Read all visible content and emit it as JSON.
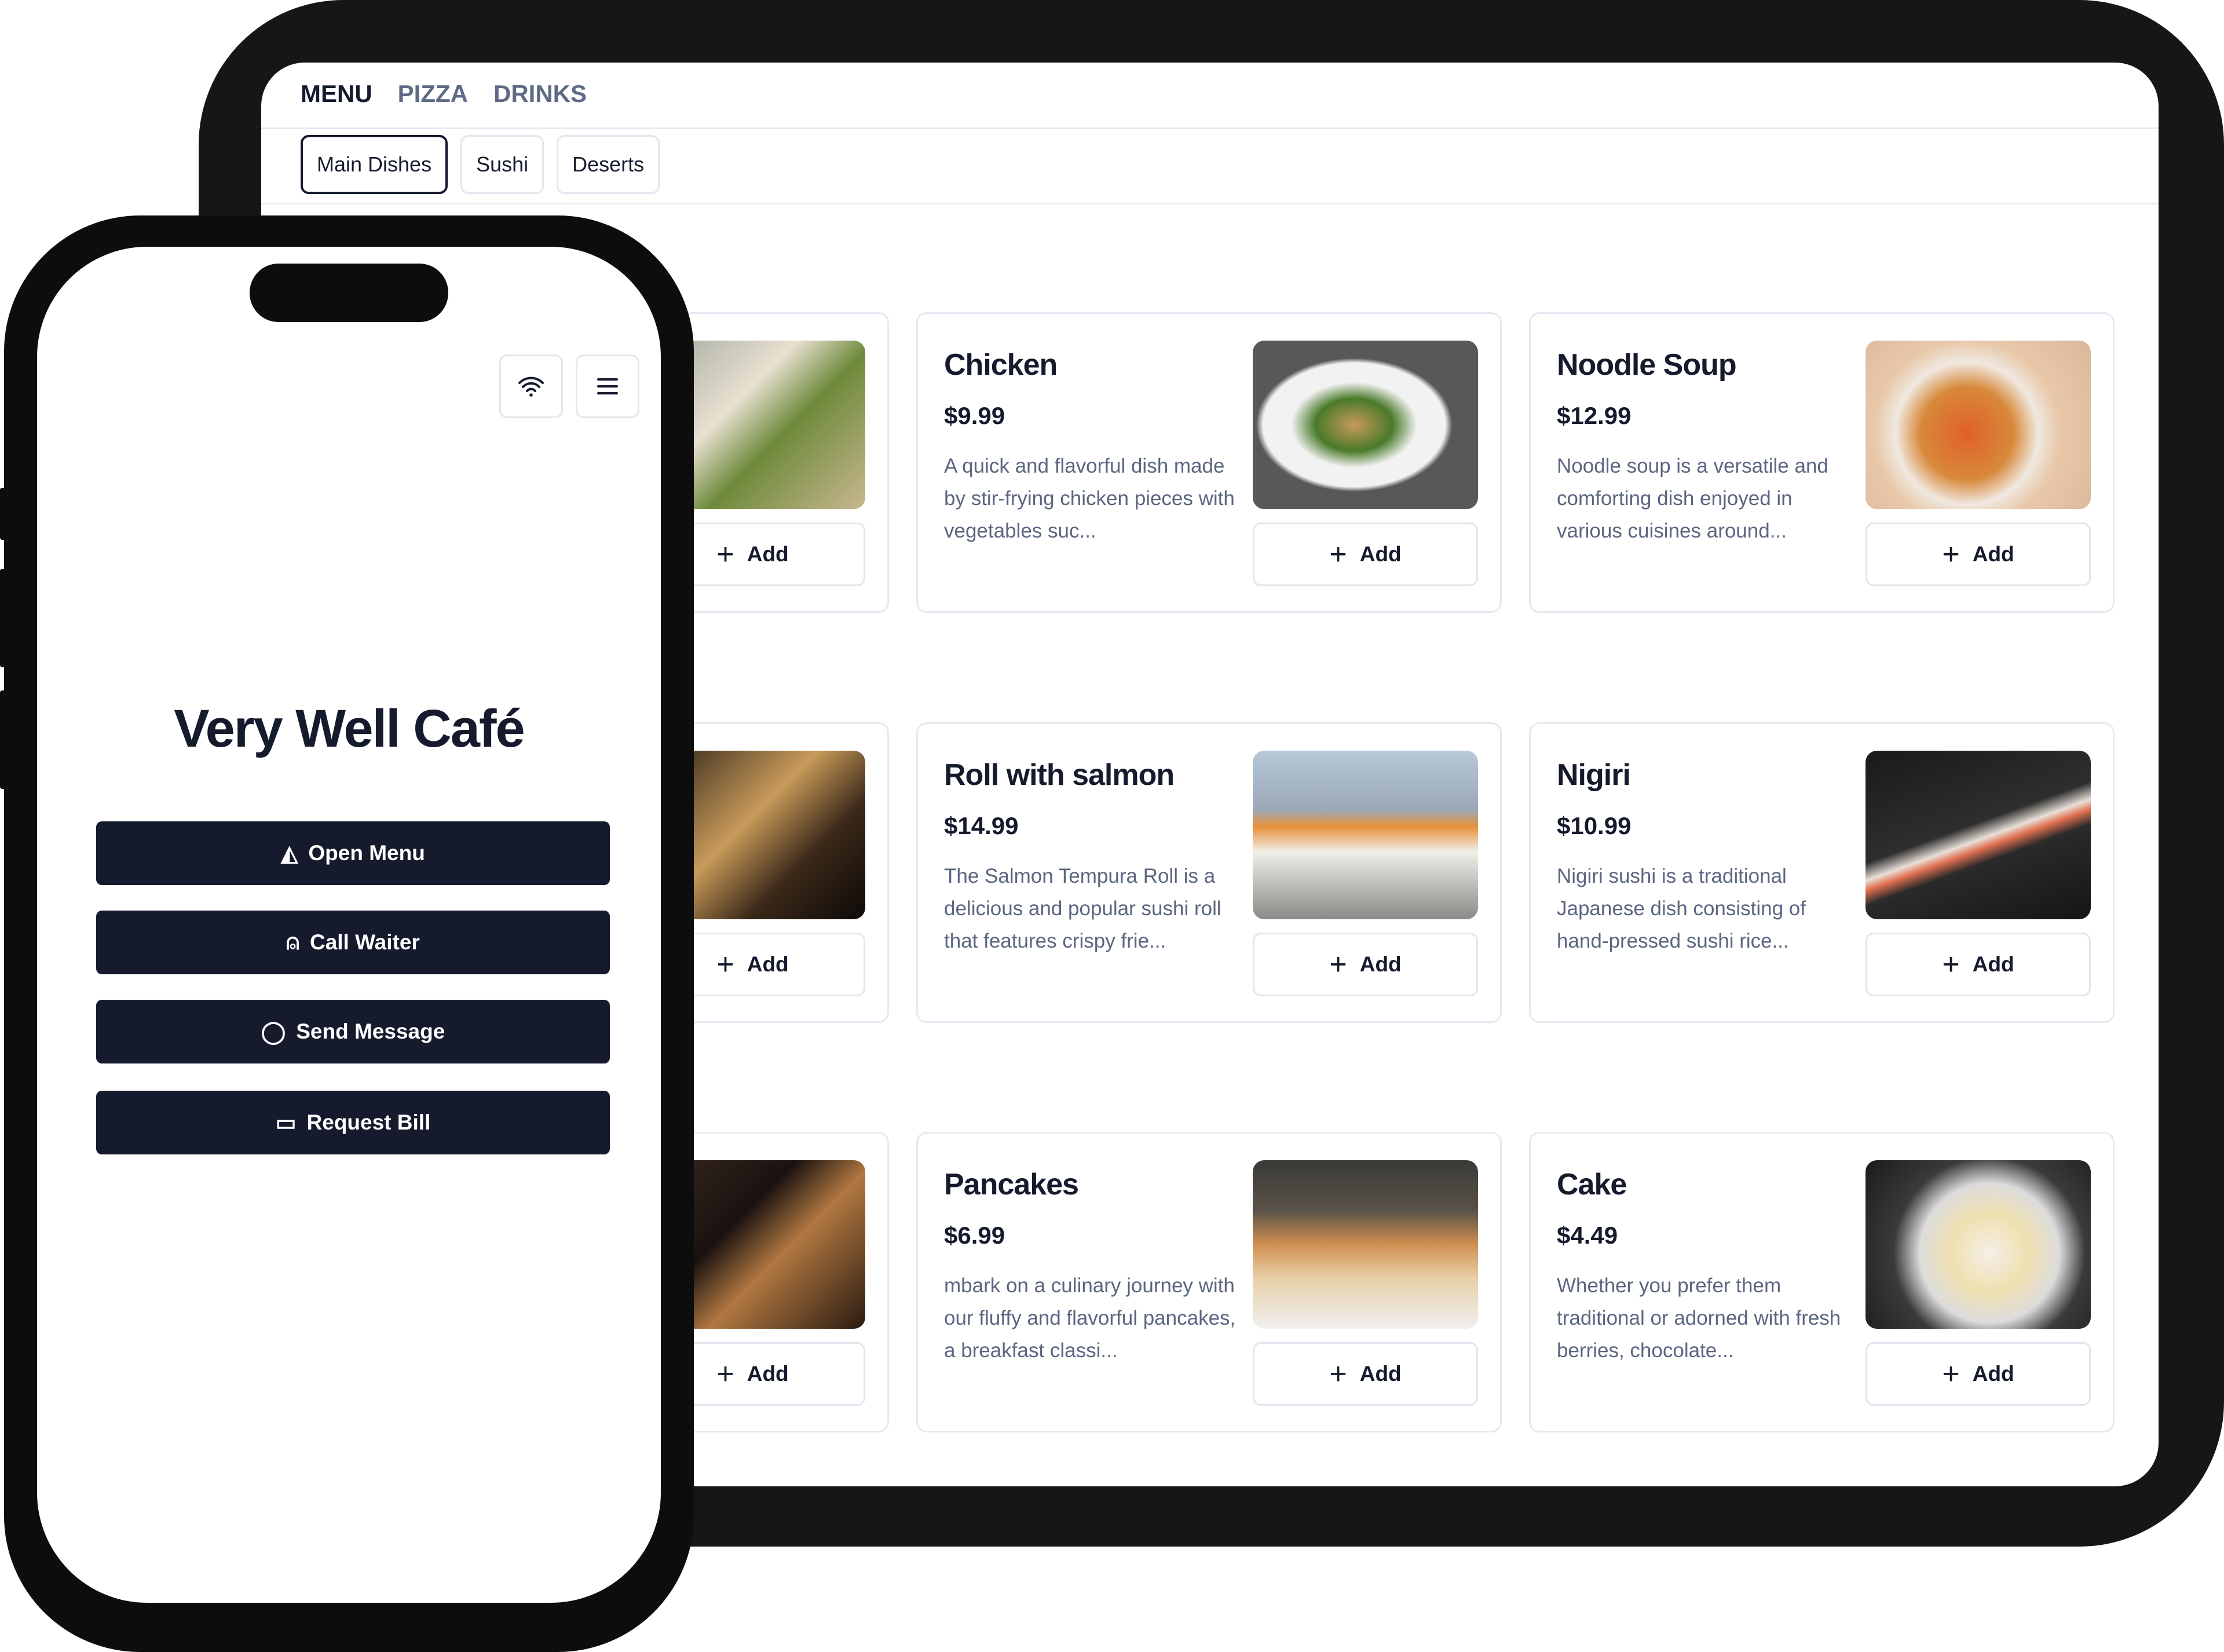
{
  "tablet": {
    "nav": [
      {
        "label": "MENU",
        "active": true
      },
      {
        "label": "PIZZA",
        "active": false
      },
      {
        "label": "DRINKS",
        "active": false
      }
    ],
    "subtabs": [
      {
        "label": "Main Dishes",
        "active": true
      },
      {
        "label": "Sushi",
        "active": false
      },
      {
        "label": "Deserts",
        "active": false
      }
    ],
    "add_label": "Add",
    "cards": [
      {
        "title": "",
        "price": "",
        "desc": "",
        "image": "linear-gradient(135deg,#9aa39a,#e8e0d0 40%,#6e8a3a 60%,#c8b890)"
      },
      {
        "title": "Chicken",
        "price": "$9.99",
        "desc": "A quick and flavorful dish made by stir-frying chicken pieces with vegetables suc...",
        "image": "radial-gradient(ellipse at 45% 50%,#c79a5a 0,#4a7a2a 22%,#f2f2f2 36%,#f2f2f2 52%,#5a5856 56%)"
      },
      {
        "title": "Noodle Soup",
        "price": "$12.99",
        "desc": "Noodle soup is a versatile and comforting dish enjoyed in various cuisines around...",
        "image": "radial-gradient(circle at 45% 55%,#e0602a 0,#d8893a 30%,#f0e8e0 46%,#e8c8a8 60%,#d8b898)"
      },
      {
        "title": "",
        "price": "",
        "desc": "",
        "image": "linear-gradient(135deg,#1a1410,#c89a5a 45%,#3a2818 70%,#0e0a08)"
      },
      {
        "title": "Roll with salmon",
        "price": "$14.99",
        "desc": "The Salmon Tempura Roll is a delicious and popular sushi roll that features crispy frie...",
        "image": "linear-gradient(180deg,#b8c8d8 0,#9aa8b8 35%,#e8903a 45%,#f0efe8 60%,#8a8a88 100%)"
      },
      {
        "title": "Nigiri",
        "price": "$10.99",
        "desc": "Nigiri sushi is a traditional Japanese dish consisting of hand-pressed sushi rice...",
        "image": "linear-gradient(160deg,#1a1a1a 0,#2e2e2e 45%,#e8e0d8 52%,#e07050 56%,#2a2a2a 62%,#151515)"
      },
      {
        "title": "",
        "price": "",
        "desc": "",
        "image": "linear-gradient(135deg,#3a2a20,#1a1210 40%,#b07840 60%,#2a1a10)"
      },
      {
        "title": "Pancakes",
        "price": "$6.99",
        "desc": "mbark on a culinary journey with our fluffy and flavorful pancakes, a breakfast classi...",
        "image": "linear-gradient(180deg,#3a3a38 0,#5a5248 30%,#d09050 50%,#e8d0a8 70%,#f0f0f0 100%)"
      },
      {
        "title": "Cake",
        "price": "$4.49",
        "desc": "Whether you prefer them traditional or adorned with fresh berries, chocolate...",
        "image": "radial-gradient(circle at 55% 55%,#f4efe8 0,#f0e0b0 25%,#dcdcdc 45%,#3a3a3a 62%,#1a1a1a)"
      }
    ]
  },
  "phone": {
    "title": "Very Well Café",
    "wifi_icon": "wifi-icon",
    "menu_icon": "hamburger-menu-icon",
    "buttons": [
      {
        "label": "Open Menu",
        "icon": "pizza-slice-icon",
        "glyph": "◭"
      },
      {
        "label": "Call Waiter",
        "icon": "user-icon",
        "glyph": "⍝"
      },
      {
        "label": "Send Message",
        "icon": "chat-bubble-icon",
        "glyph": "◯"
      },
      {
        "label": "Request Bill",
        "icon": "wallet-icon",
        "glyph": "▭"
      }
    ],
    "button_color": "#151b2d"
  }
}
